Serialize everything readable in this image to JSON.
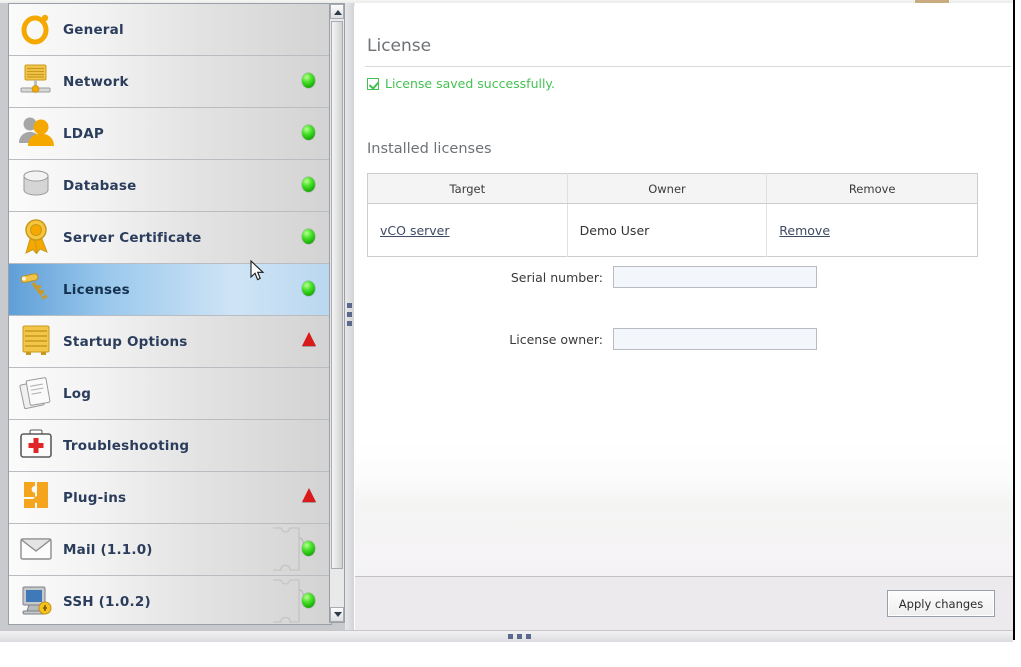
{
  "sidebar": {
    "items": [
      {
        "label": "General",
        "icon": "ring-icon",
        "status": "none"
      },
      {
        "label": "Network",
        "icon": "network-icon",
        "status": "green"
      },
      {
        "label": "LDAP",
        "icon": "users-icon",
        "status": "green"
      },
      {
        "label": "Database",
        "icon": "database-icon",
        "status": "green"
      },
      {
        "label": "Server Certificate",
        "icon": "certificate-icon",
        "status": "green"
      },
      {
        "label": "Licenses",
        "icon": "keys-icon",
        "status": "green",
        "selected": true
      },
      {
        "label": "Startup Options",
        "icon": "server-rack-icon",
        "status": "warning"
      },
      {
        "label": "Log",
        "icon": "documents-icon",
        "status": "none"
      },
      {
        "label": "Troubleshooting",
        "icon": "first-aid-kit-icon",
        "status": "none"
      },
      {
        "label": "Plug-ins",
        "icon": "puzzle-piece-icon",
        "status": "warning"
      },
      {
        "label": "Mail (1.1.0)",
        "icon": "mail-envelope-icon",
        "status": "green",
        "plugin": true
      },
      {
        "label": "SSH (1.0.2)",
        "icon": "ssh-computer-icon",
        "status": "green",
        "plugin": true
      }
    ]
  },
  "content": {
    "page_title": "License",
    "status_message": "License saved successfully.",
    "section_title": "Installed licenses",
    "table": {
      "headers": [
        "Target",
        "Owner",
        "Remove"
      ],
      "rows": [
        {
          "target": "vCO server",
          "owner": "Demo User",
          "remove": "Remove"
        }
      ]
    },
    "form": {
      "serial_label": "Serial number:",
      "serial_value": "",
      "owner_label": "License owner:",
      "owner_value": ""
    },
    "apply_label": "Apply changes"
  },
  "colors": {
    "status_green": "#44c252",
    "warning_red": "#d81a1a",
    "selection_blue": "#5f9fd8",
    "title_gray": "#6e7276"
  }
}
